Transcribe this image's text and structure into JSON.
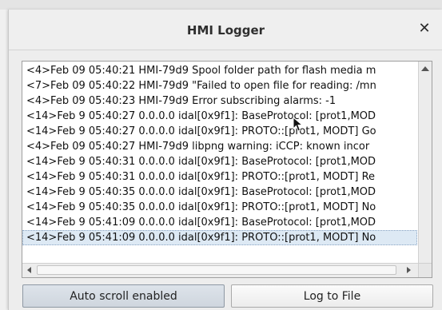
{
  "window": {
    "title": "HMI Logger",
    "close_glyph": "✕"
  },
  "log": {
    "lines": [
      "<4>Feb 09 05:40:21 HMI-79d9 Spool folder path for flash media m",
      "<7>Feb 09 05:40:22 HMI-79d9 \"Failed to open file for reading: /mn",
      "<4>Feb 09 05:40:23 HMI-79d9 Error subscribing alarms: -1",
      "<14>Feb  9 05:40:27 0.0.0.0  idal[0x9f1]: BaseProtocol: [prot1,MOD",
      "<14>Feb  9 05:40:27 0.0.0.0  idal[0x9f1]: PROTO::[prot1, MODT] Go",
      "<4>Feb 09 05:40:27 HMI-79d9 libpng warning: iCCP: known incor",
      "<14>Feb  9 05:40:31 0.0.0.0  idal[0x9f1]: BaseProtocol: [prot1,MOD",
      "<14>Feb  9 05:40:31 0.0.0.0  idal[0x9f1]: PROTO::[prot1, MODT] Re",
      "<14>Feb  9 05:40:35 0.0.0.0  idal[0x9f1]: BaseProtocol: [prot1,MOD",
      "<14>Feb  9 05:40:35 0.0.0.0  idal[0x9f1]: PROTO::[prot1, MODT] No",
      "<14>Feb  9 05:41:09 0.0.0.0  idal[0x9f1]: BaseProtocol: [prot1,MOD",
      "<14>Feb  9 05:41:09 0.0.0.0  idal[0x9f1]: PROTO::[prot1, MODT] No"
    ],
    "selected_index": 11
  },
  "buttons": {
    "autoscroll_label": "Auto scroll enabled",
    "logfile_label": "Log to File"
  },
  "icons": {
    "close": "close-icon",
    "cursor": "mouse-pointer-icon",
    "scroll_up": "arrow-up-icon",
    "scroll_left": "arrow-left-icon",
    "scroll_right": "arrow-right-icon"
  }
}
